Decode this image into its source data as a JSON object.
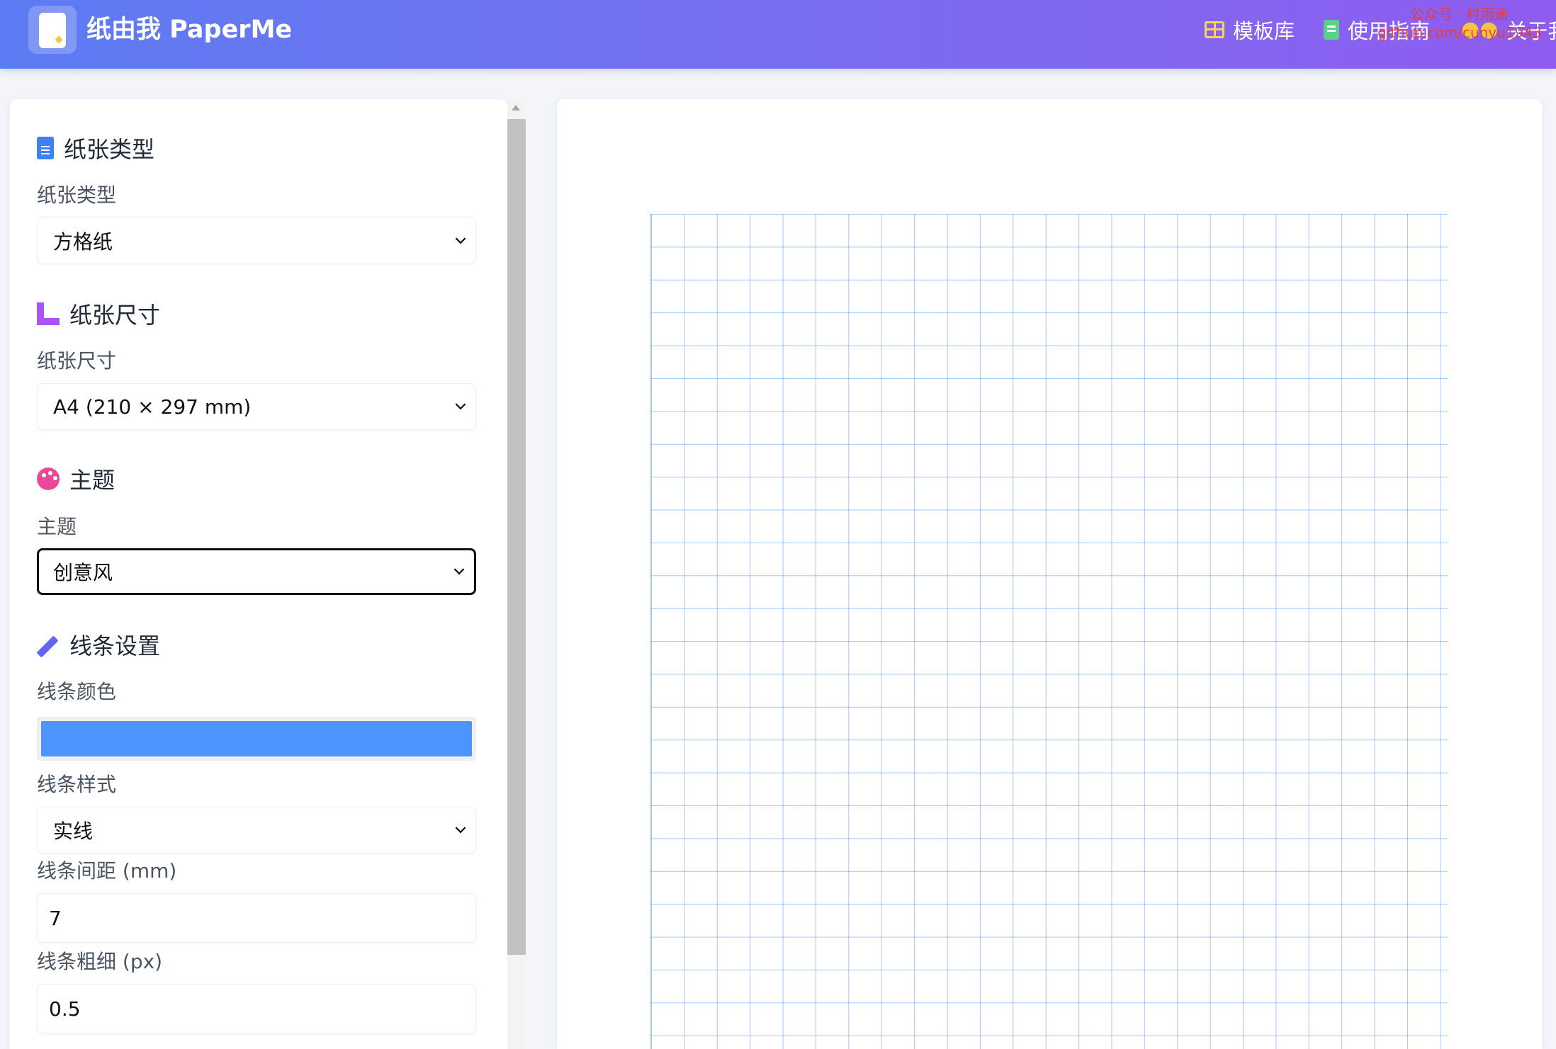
{
  "header": {
    "brand": "纸由我 PaperMe",
    "nav": [
      {
        "label": "模板库",
        "icon": "grid-icon"
      },
      {
        "label": "使用指南",
        "icon": "book-icon"
      },
      {
        "label": "关于我",
        "icon": "people-icon"
      }
    ],
    "watermark_line1": "公众号 · 村雨遥",
    "watermark_line2": "github.com/cunyu1943"
  },
  "sections": {
    "paper_type": {
      "title": "纸张类型",
      "label": "纸张类型",
      "value": "方格纸",
      "icon": "file-icon"
    },
    "paper_size": {
      "title": "纸张尺寸",
      "label": "纸张尺寸",
      "value": "A4 (210 × 297 mm)",
      "icon": "ruler-icon"
    },
    "theme": {
      "title": "主题",
      "label": "主题",
      "value": "创意风",
      "icon": "palette-icon"
    },
    "line": {
      "title": "线条设置",
      "icon": "pencil-icon",
      "color_label": "线条颜色",
      "color_value": "#4d94ff",
      "style_label": "线条样式",
      "style_value": "实线",
      "spacing_label": "线条间距 (mm)",
      "spacing_value": "7",
      "width_label": "线条粗细 (px)",
      "width_value": "0.5"
    }
  },
  "preview": {
    "grid_color": "#3b82f6"
  }
}
